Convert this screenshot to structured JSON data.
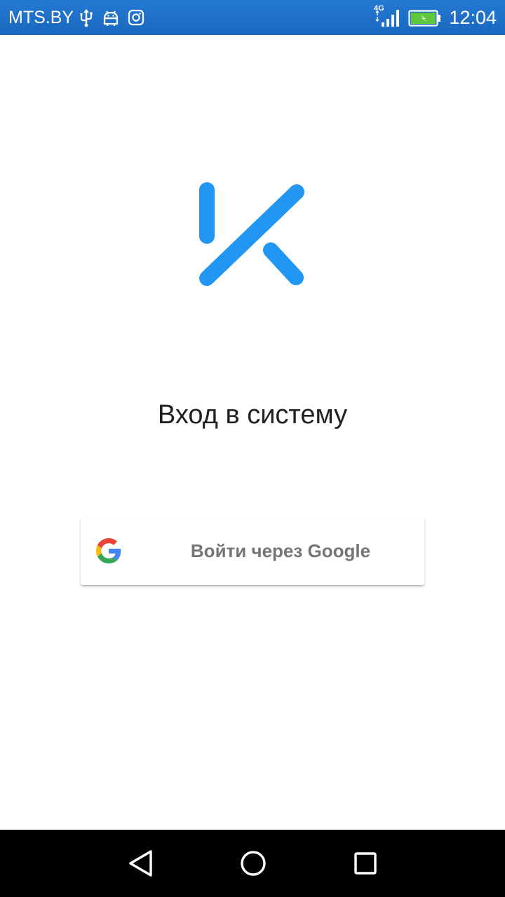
{
  "status_bar": {
    "carrier": "MTS.BY",
    "network_type": "4G",
    "time": "12:04",
    "background_color": "#1c6fc6",
    "icons": [
      "usb-icon",
      "android-debug-icon",
      "instagram-icon",
      "signal-icon",
      "battery-charging-icon"
    ]
  },
  "login": {
    "logo_color": "#2196f3",
    "title": "Вход в систему",
    "google_button_label": "Войти через Google"
  },
  "navigation_bar": {
    "buttons": [
      "back-icon",
      "home-icon",
      "recents-icon"
    ]
  }
}
